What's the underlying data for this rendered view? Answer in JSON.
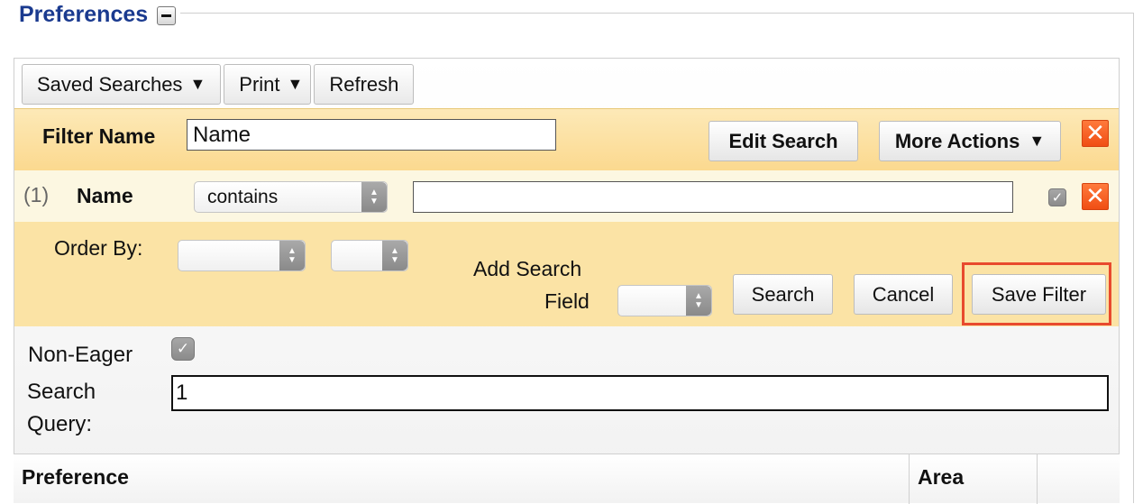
{
  "section": {
    "title": "Preferences"
  },
  "toolbar": {
    "saved_searches_label": "Saved Searches",
    "print_label": "Print",
    "refresh_label": "Refresh",
    "dropdown_caret": "▼"
  },
  "filter": {
    "name_label": "Filter Name",
    "name_value": "Name",
    "edit_search_label": "Edit Search",
    "more_actions_label": "More Actions",
    "remove_glyph": "✕"
  },
  "criteria": [
    {
      "index_label": "(1)",
      "field_label": "Name",
      "operator": "contains",
      "value": "",
      "enabled": true
    }
  ],
  "order": {
    "order_by_label": "Order By:",
    "order_field_value": "",
    "order_dir_value": "",
    "add_field_label_1": "Add Search",
    "add_field_label_2": "Field",
    "add_field_value": "",
    "search_button": "Search",
    "cancel_button": "Cancel",
    "save_filter_button": "Save Filter"
  },
  "options": {
    "non_eager_label": "Non-Eager",
    "non_eager_checked": true,
    "search_query_label_1": "Search",
    "search_query_label_2": "Query:",
    "search_query_value": "1"
  },
  "table": {
    "columns": [
      "Preference",
      "Area",
      ""
    ]
  },
  "colors": {
    "title": "#1a3a8f",
    "filter_band": "#fbd98f",
    "order_band": "#fbe3a5",
    "criterion_band": "#fcf7e1",
    "remove_button": "#f04e14",
    "highlight": "#e84a2e"
  }
}
